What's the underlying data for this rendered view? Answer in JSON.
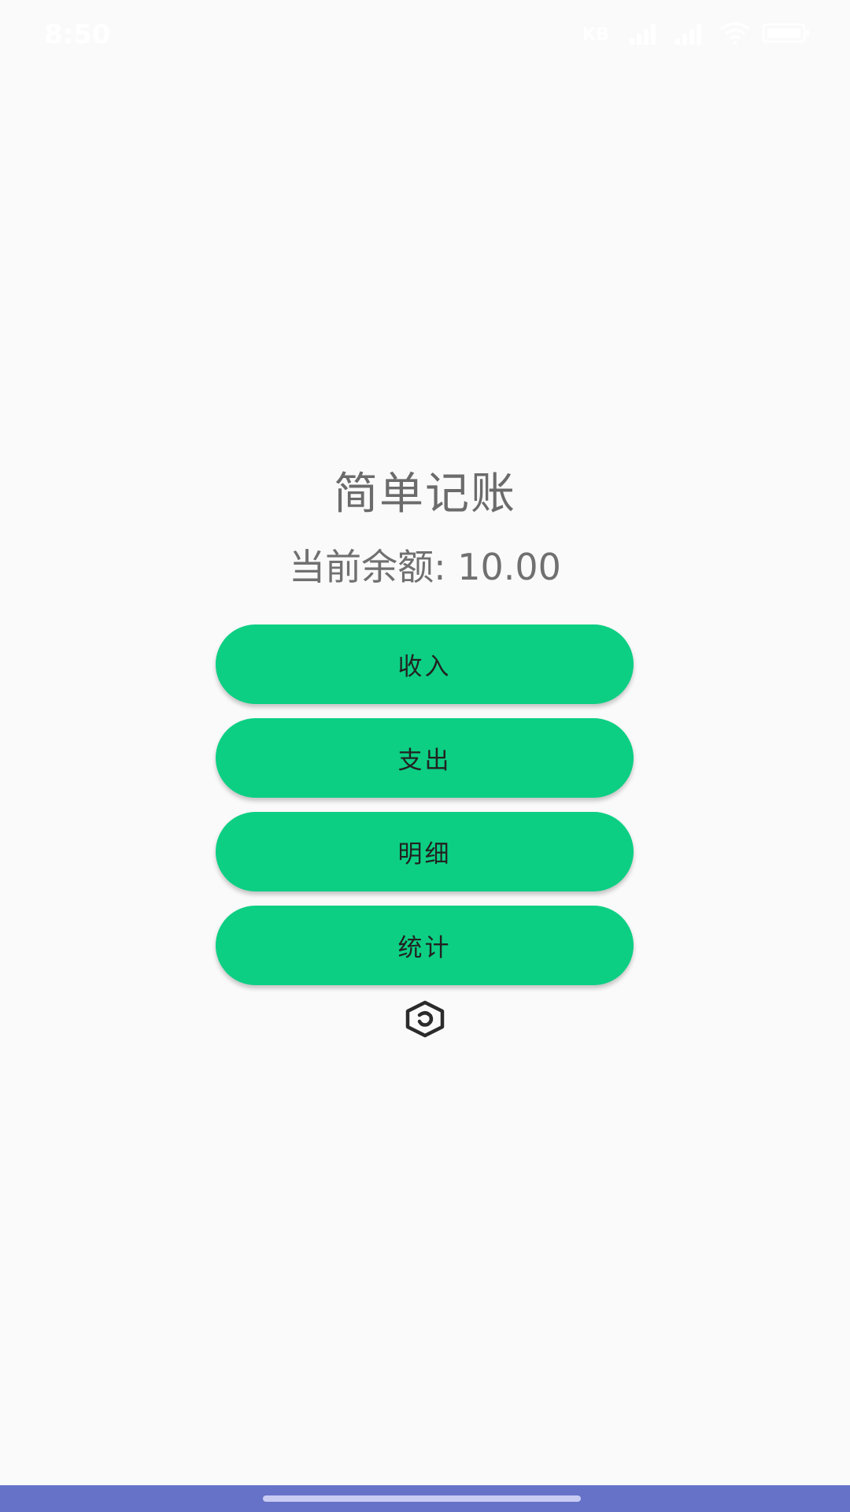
{
  "status_bar": {
    "time": "8:50",
    "icons": [
      "data-speed-icon",
      "signal-icon",
      "signal-icon",
      "wifi-icon",
      "battery-icon"
    ]
  },
  "app": {
    "title": "简单记账",
    "balance_text": "当前余额: 10.00"
  },
  "buttons": {
    "income": "收入",
    "expense": "支出",
    "detail": "明细",
    "stats": "统计"
  },
  "colors": {
    "background": "#fafafa",
    "button": "#0ccf83",
    "nav_bar": "#6572c8"
  }
}
